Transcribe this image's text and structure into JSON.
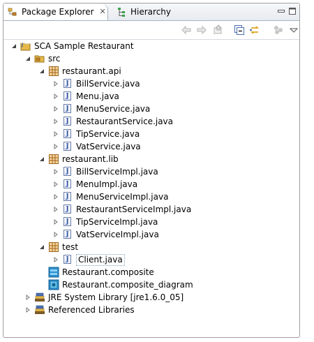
{
  "tabs": [
    {
      "label": "Package Explorer",
      "close": "✕",
      "icon": "package-explorer-icon"
    },
    {
      "label": "Hierarchy",
      "icon": "hierarchy-icon"
    }
  ],
  "toolbar": {
    "buttons": [
      "back-icon",
      "forward-icon",
      "up-icon",
      "collapse-all-icon",
      "link-with-editor-icon",
      "view-menu-icon"
    ]
  },
  "tree": {
    "project": "SCA Sample Restaurant",
    "src": "src",
    "packages": [
      {
        "name": "restaurant.api",
        "files": [
          "BillService.java",
          "Menu.java",
          "MenuService.java",
          "RestaurantService.java",
          "TipService.java",
          "VatService.java"
        ]
      },
      {
        "name": "restaurant.lib",
        "files": [
          "BillServiceImpl.java",
          "MenuImpl.java",
          "MenuServiceImpl.java",
          "RestaurantServiceImpl.java",
          "TipServiceImpl.java",
          "VatServiceImpl.java"
        ]
      },
      {
        "name": "test",
        "files": [
          "Client.java"
        ]
      }
    ],
    "composite": "Restaurant.composite",
    "composite_diagram": "Restaurant.composite_diagram",
    "jre": "JRE System Library [jre1.6.0_05]",
    "refs": "Referenced Libraries"
  },
  "colors": {
    "accent": "#3a5fa6",
    "package": "#c8862a",
    "folder": "#e6b84a"
  }
}
